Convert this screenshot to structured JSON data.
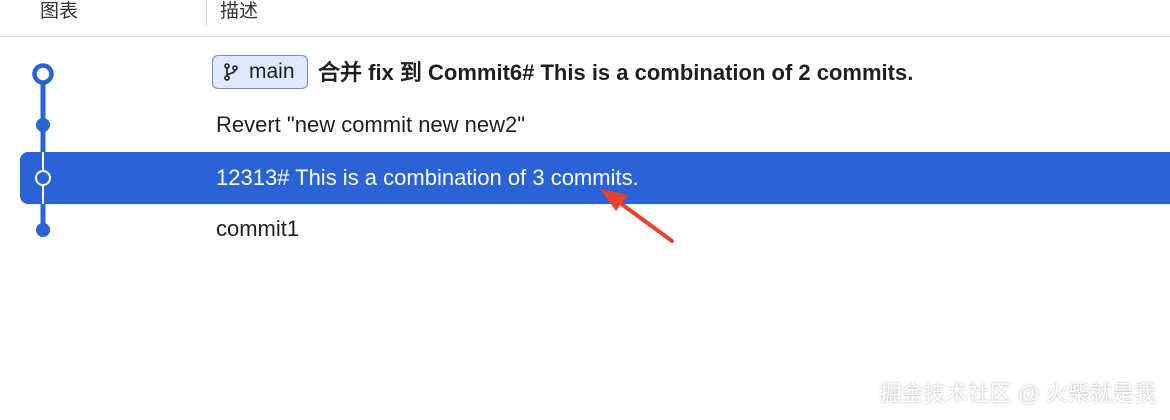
{
  "header": {
    "graph_col": "图表",
    "desc_col": "描述"
  },
  "commits": [
    {
      "message": "合并 fix 到 Commit6# This is a combination of 2 commits.",
      "branch": "main",
      "head": true
    },
    {
      "message": "Revert \"new commit  new new2\""
    },
    {
      "message": "12313# This is a combination of 3 commits.",
      "selected": true
    },
    {
      "message": "commit1"
    }
  ],
  "icons": {
    "branch": "git-branch-icon",
    "annotation": "red-arrow"
  },
  "colors": {
    "graph_line": "#2a63d6",
    "selection": "#2a63d6",
    "branch_tag_bg": "#dfe9fb",
    "annotation_arrow": "#e8412c"
  },
  "watermark": "掘金技术社区 @ 火柴就是我"
}
